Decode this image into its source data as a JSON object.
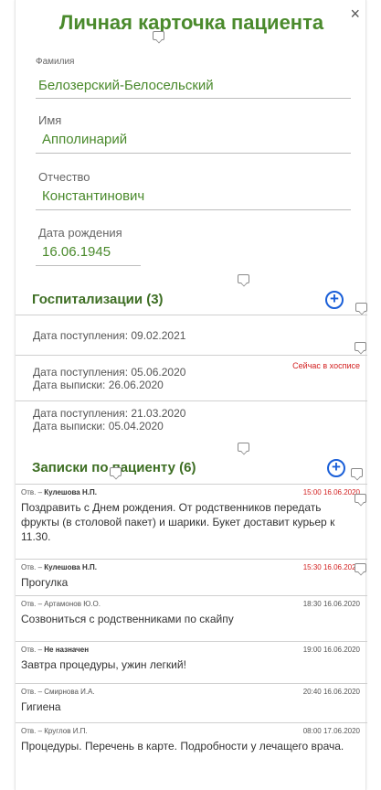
{
  "card": {
    "title": "Личная карточка пациента",
    "close_symbol": "×"
  },
  "fields": {
    "surname": {
      "label": "Фамилия",
      "value": "Белозерский-Белосельский"
    },
    "name": {
      "label": "Имя",
      "value": "Апполинарий"
    },
    "patronymic": {
      "label": "Отчество",
      "value": "Константинович"
    },
    "birthdate": {
      "label": "Дата рождения",
      "value": "16.06.1945"
    }
  },
  "hospitalizations": {
    "title": "Госпитализации (3)",
    "add_symbol": "+",
    "items": [
      {
        "admission": "Дата поступления: 09.02.2021",
        "discharge": "",
        "badge": ""
      },
      {
        "admission": "Дата поступления: 05.06.2020",
        "discharge": "Дата выписки: 26.06.2020",
        "badge": "Сейчас в хосписе"
      },
      {
        "admission": "Дата поступления: 21.03.2020",
        "discharge": "Дата выписки: 05.04.2020",
        "badge": ""
      }
    ]
  },
  "notes": {
    "title": "Записки по пациенту (6)",
    "add_symbol": "+",
    "items": [
      {
        "prefix": "Отв. – ",
        "person": "Кулешова Н.П.",
        "bold": true,
        "time": "15:00 16.06.2020",
        "highlight": true,
        "text": "Поздравить с Днем рождения. От родственников передать фрукты (в столовой пакет) и шарики. Букет доставит курьер к 11.30."
      },
      {
        "prefix": "Отв. – ",
        "person": "Кулешова Н.П.",
        "bold": true,
        "time": "15:30 16.06.2020",
        "highlight": true,
        "text": "Прогулка"
      },
      {
        "prefix": "Отв. – ",
        "person": "Артамонов Ю.О.",
        "bold": false,
        "time": "18:30 16.06.2020",
        "highlight": false,
        "text": "Созвониться с родственниками по скайпу"
      },
      {
        "prefix": "Отв. – ",
        "person": "Не назначен",
        "bold": true,
        "time": "19:00 16.06.2020",
        "highlight": false,
        "text": "Завтра процедуры, ужин легкий!"
      },
      {
        "prefix": "Отв. – ",
        "person": "Смирнова И.А.",
        "bold": false,
        "time": "20:40 16.06.2020",
        "highlight": false,
        "text": "Гигиена"
      },
      {
        "prefix": "Отв. – ",
        "person": "Круглов И.П.",
        "bold": false,
        "time": "08:00 17.06.2020",
        "highlight": false,
        "text": "Процедуры. Перечень в карте. Подробности у лечащего врача."
      }
    ]
  },
  "colors": {
    "accent_green": "#4a8a2c",
    "section_green": "#3d6e23",
    "plus_blue": "#1a5fd8",
    "alert_red": "#d21f1f"
  },
  "icons": {
    "close": "close-icon",
    "add": "plus-circle-icon",
    "comment": "comment-icon"
  }
}
